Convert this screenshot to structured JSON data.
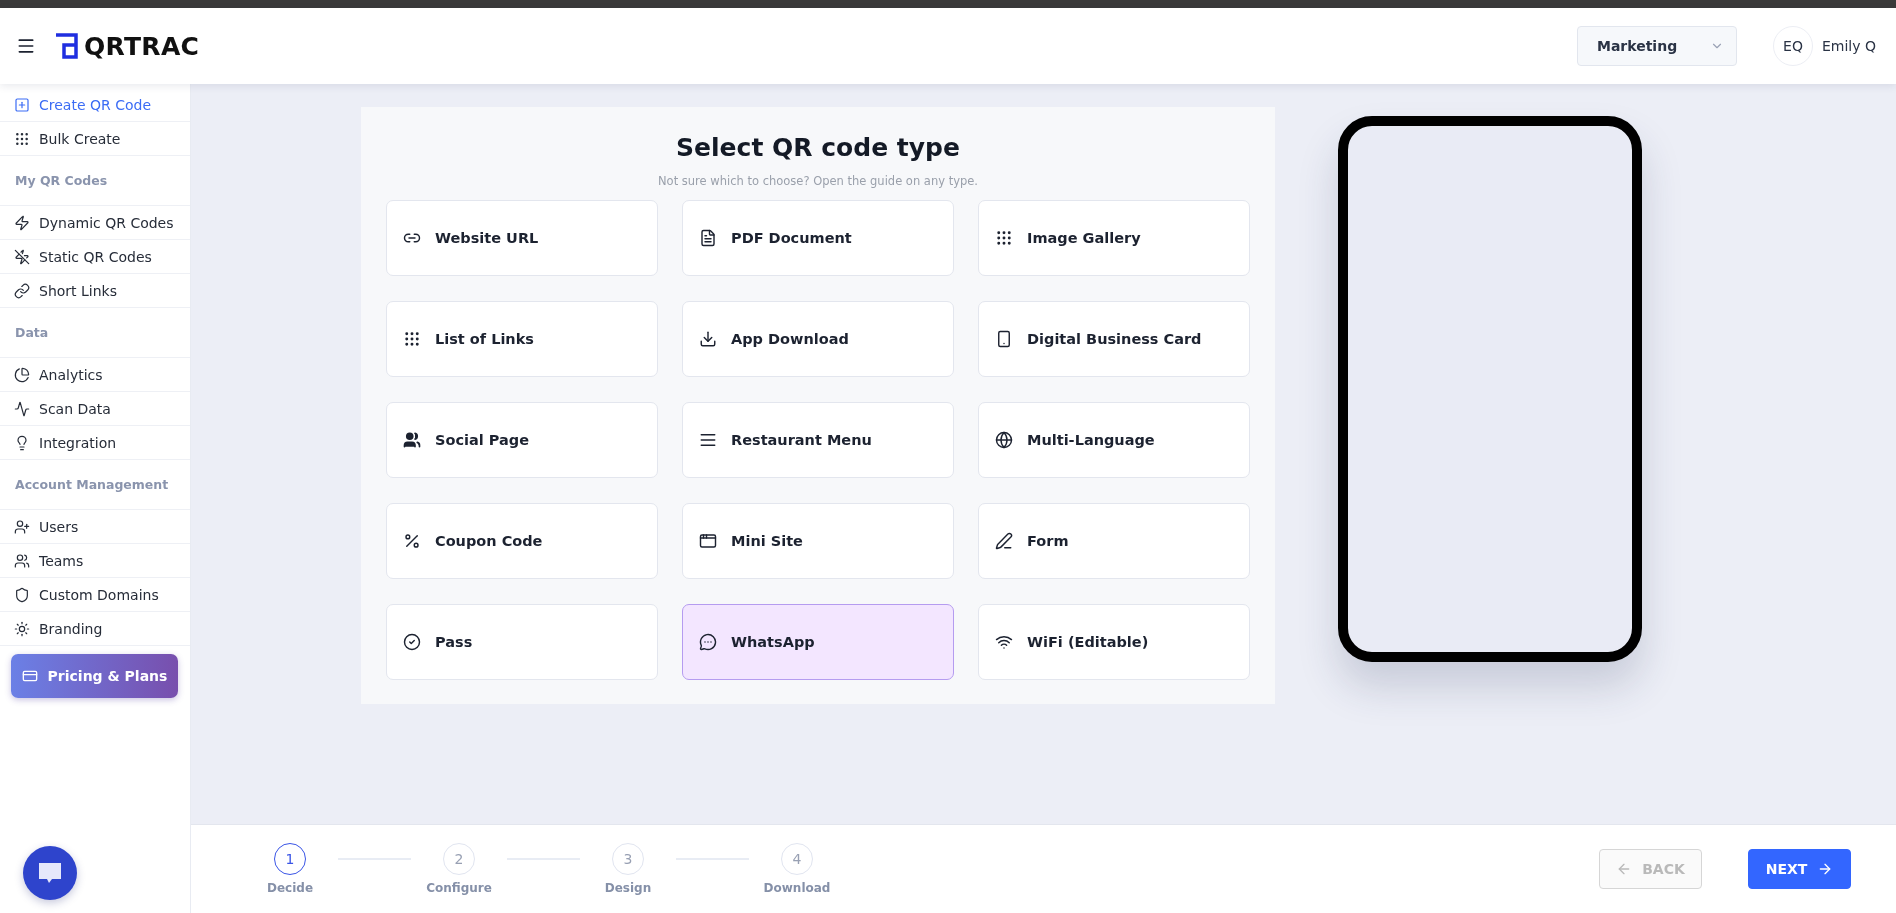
{
  "header": {
    "logo": "QRTRAC",
    "workspace": "Marketing",
    "avatar": "EQ",
    "user": "Emily Q"
  },
  "sidebar": {
    "items": [
      {
        "kind": "item",
        "label": "Create QR Code",
        "selected": true
      },
      {
        "kind": "item",
        "label": "Bulk Create",
        "selected": false
      },
      {
        "kind": "heading",
        "label": "My QR Codes"
      },
      {
        "kind": "item",
        "label": "Dynamic QR Codes",
        "selected": false
      },
      {
        "kind": "item",
        "label": "Static QR Codes",
        "selected": false
      },
      {
        "kind": "item",
        "label": "Short Links",
        "selected": false
      },
      {
        "kind": "heading",
        "label": "Data"
      },
      {
        "kind": "item",
        "label": "Analytics",
        "selected": false
      },
      {
        "kind": "item",
        "label": "Scan Data",
        "selected": false
      },
      {
        "kind": "item",
        "label": "Integration",
        "selected": false
      },
      {
        "kind": "heading",
        "label": "Account Management"
      },
      {
        "kind": "item",
        "label": "Users",
        "selected": false
      },
      {
        "kind": "item",
        "label": "Teams",
        "selected": false
      },
      {
        "kind": "item",
        "label": "Custom Domains",
        "selected": false
      },
      {
        "kind": "item",
        "label": "Branding",
        "selected": false
      }
    ],
    "pricing": "Pricing & Plans"
  },
  "panel": {
    "title": "Select QR code type",
    "subtitle": "Not sure which to choose? Open the guide on any type.",
    "types": [
      {
        "label": "Website URL",
        "selected": false
      },
      {
        "label": "PDF Document",
        "selected": false
      },
      {
        "label": "Image Gallery",
        "selected": false
      },
      {
        "label": "List of Links",
        "selected": false
      },
      {
        "label": "App Download",
        "selected": false
      },
      {
        "label": "Digital Business Card",
        "selected": false
      },
      {
        "label": "Social Page",
        "selected": false
      },
      {
        "label": "Restaurant Menu",
        "selected": false
      },
      {
        "label": "Multi-Language",
        "selected": false
      },
      {
        "label": "Coupon Code",
        "selected": false
      },
      {
        "label": "Mini Site",
        "selected": false
      },
      {
        "label": "Form",
        "selected": false
      },
      {
        "label": "Pass",
        "selected": false
      },
      {
        "label": "WhatsApp",
        "selected": true
      },
      {
        "label": "WiFi (Editable)",
        "selected": false
      }
    ]
  },
  "steps": [
    {
      "number": "1",
      "label": "Decide",
      "selected": true
    },
    {
      "number": "2",
      "label": "Configure",
      "selected": false
    },
    {
      "number": "3",
      "label": "Design",
      "selected": false
    },
    {
      "number": "4",
      "label": "Download",
      "selected": false
    }
  ],
  "back": {
    "label": "BACK",
    "disabled": true
  },
  "next": {
    "label": "NEXT",
    "disabled": false
  }
}
